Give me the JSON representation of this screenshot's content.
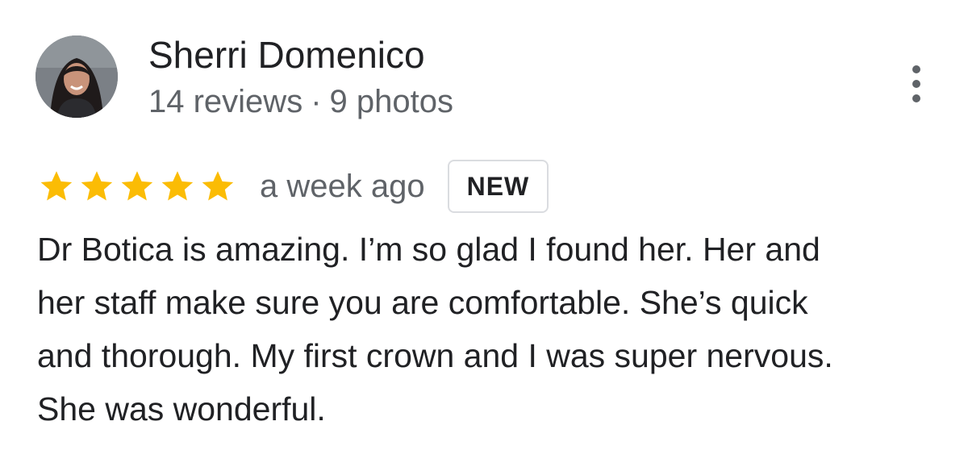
{
  "review": {
    "author": {
      "name": "Sherri Domenico",
      "reviews_count": "14 reviews",
      "separator": "·",
      "photos_count": "9 photos",
      "avatar_icon": "profile-photo"
    },
    "more_options_icon": "more-vertical-icon",
    "rating": {
      "stars": 5,
      "max_stars": 5,
      "star_color": "#fbbc04"
    },
    "date": "a week ago",
    "badge": "NEW",
    "text": "Dr Botica is amazing. I’m so glad I found her. Her and\nher staff make sure you are comfortable. She’s quick\nand thorough.  My first crown and I was super nervous.\nShe was wonderful."
  },
  "colors": {
    "primary_text": "#202124",
    "secondary_text": "#5f6368",
    "badge_border": "#dadce0",
    "star": "#fbbc04"
  }
}
